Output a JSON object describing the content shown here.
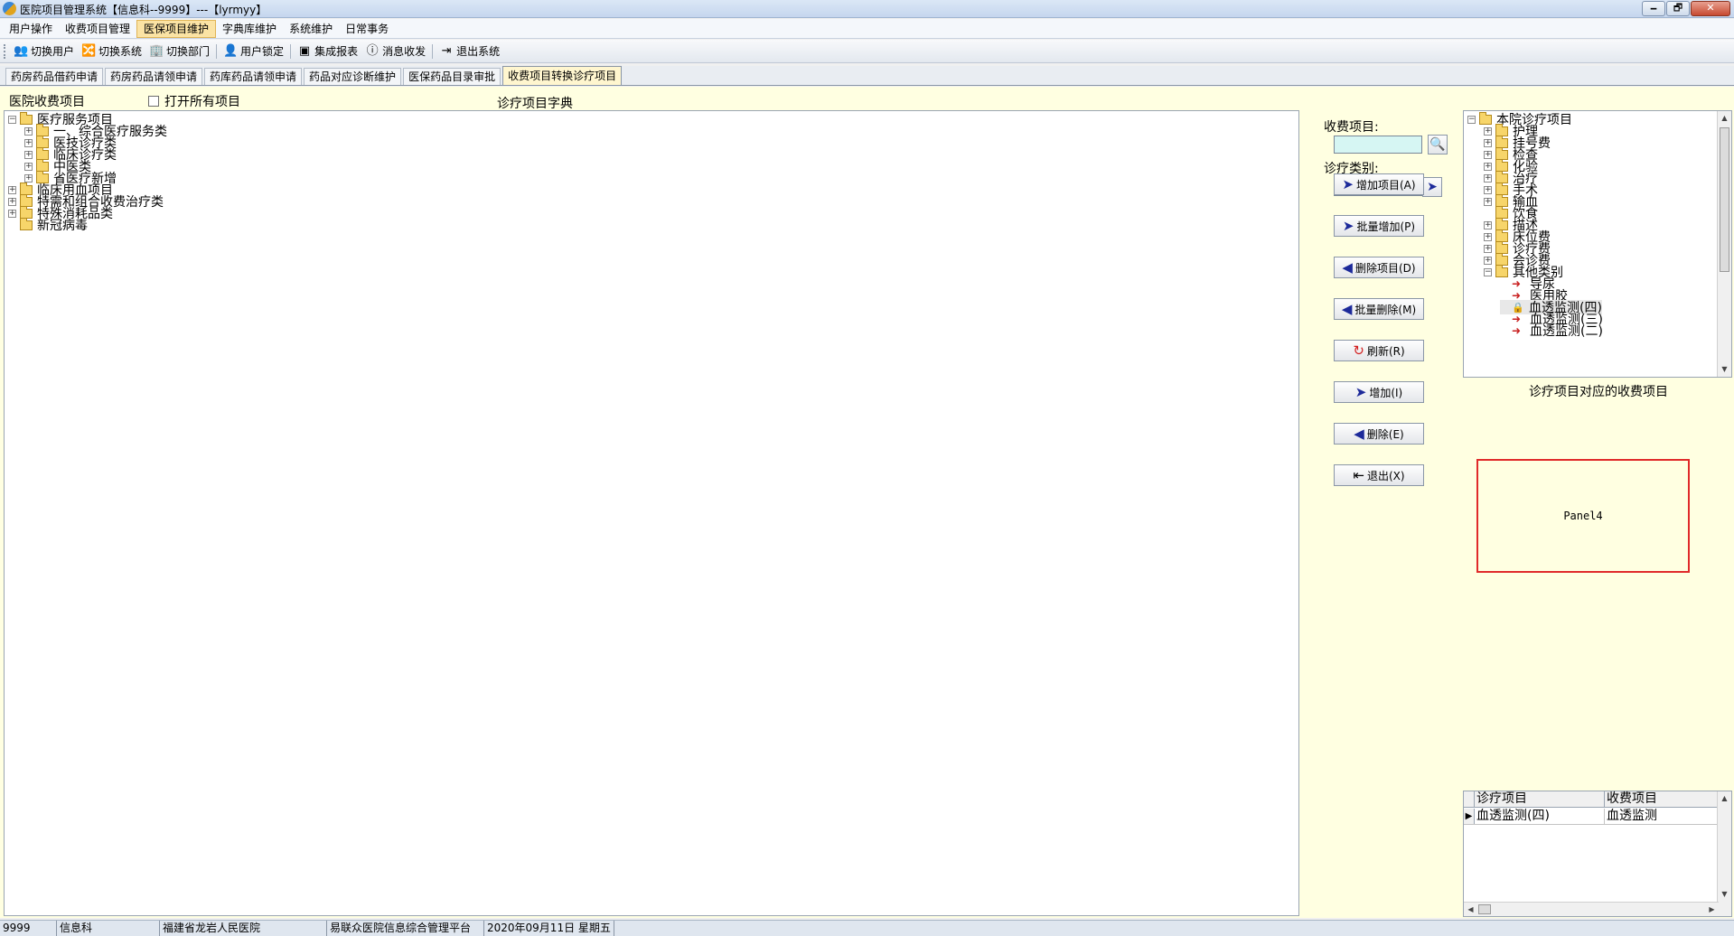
{
  "window": {
    "title": "医院项目管理系统【信息科--9999】---【lyrmyy】",
    "controls": [
      "🗕",
      "🗗",
      "✕"
    ]
  },
  "menu": [
    "用户操作",
    "收费项目管理",
    "医保项目维护",
    "字典库维护",
    "系统维护",
    "日常事务"
  ],
  "toolbar": [
    {
      "label": "切换用户",
      "icon": "users-icon",
      "glyph": "👥"
    },
    {
      "label": "切换系统",
      "icon": "switch-system-icon",
      "glyph": "🔀"
    },
    {
      "label": "切换部门",
      "icon": "department-icon",
      "glyph": "🏢"
    },
    {
      "label": "用户锁定",
      "icon": "user-lock-icon",
      "glyph": "👤"
    },
    {
      "label": "集成报表",
      "icon": "report-icon",
      "glyph": "▣"
    },
    {
      "label": "消息收发",
      "icon": "info-icon",
      "glyph": "ⓘ"
    },
    {
      "label": "退出系统",
      "icon": "exit-icon",
      "glyph": "⇥"
    }
  ],
  "tabs": [
    "药房药品借药申请",
    "药房药品请领申请",
    "药库药品请领申请",
    "药品对应诊断维护",
    "医保药品目录审批",
    "收费项目转换诊疗项目"
  ],
  "main": {
    "left_title": "医院收费项目",
    "open_all_label": "打开所有项目",
    "dict_title": "诊疗项目字典",
    "left_tree": [
      {
        "label": "医疗服务项目",
        "level": 0,
        "expander": "⊟",
        "kind": "folder"
      },
      {
        "label": "一、综合医疗服务类",
        "level": 1,
        "expander": "⊞",
        "kind": "folder"
      },
      {
        "label": "医技诊疗类",
        "level": 1,
        "expander": "⊞",
        "kind": "folder"
      },
      {
        "label": "临床诊疗类",
        "level": 1,
        "expander": "⊞",
        "kind": "folder"
      },
      {
        "label": "中医类",
        "level": 1,
        "expander": "⊞",
        "kind": "folder"
      },
      {
        "label": "省医疗新增",
        "level": 1,
        "expander": "⊞",
        "kind": "folder"
      },
      {
        "label": "临床用血项目",
        "level": 0,
        "expander": "⊞",
        "kind": "folder"
      },
      {
        "label": "特需和组合收费治疗类",
        "level": 0,
        "expander": "⊞",
        "kind": "folder"
      },
      {
        "label": "特殊消耗品类",
        "level": 0,
        "expander": "⊞",
        "kind": "folder"
      },
      {
        "label": "新冠病毒",
        "level": 0,
        "expander": "",
        "kind": "folder"
      }
    ],
    "controls": {
      "charge_item_label": "收费项目:",
      "treat_category_label": "诊疗类别:",
      "charge_item_value": "",
      "treat_category_value": "",
      "buttons": [
        {
          "label": "增加项目(A)",
          "icon": "arrow-right-icon",
          "glyph": "➤",
          "tone": "navy"
        },
        {
          "label": "批量增加(P)",
          "icon": "arrow-right-icon",
          "glyph": "➤",
          "tone": "navy"
        },
        {
          "label": "删除项目(D)",
          "icon": "arrow-left-icon",
          "glyph": "◀",
          "tone": "navy"
        },
        {
          "label": "批量删除(M)",
          "icon": "arrow-left-icon",
          "glyph": "◀",
          "tone": "navy"
        },
        {
          "label": "刷新(R)",
          "icon": "refresh-icon",
          "glyph": "↻",
          "tone": "red"
        },
        {
          "label": "增加(I)",
          "icon": "arrow-right-icon",
          "glyph": "➤",
          "tone": "navy"
        },
        {
          "label": "删除(E)",
          "icon": "arrow-left-icon",
          "glyph": "◀",
          "tone": "navy"
        },
        {
          "label": "退出(X)",
          "icon": "exit-door-icon",
          "glyph": "⇤",
          "tone": "dark"
        }
      ]
    },
    "right_tree": [
      {
        "label": "本院诊疗项目",
        "level": 0,
        "expander": "⊟",
        "kind": "folder"
      },
      {
        "label": "护理",
        "level": 1,
        "expander": "⊞",
        "kind": "folder"
      },
      {
        "label": "挂号费",
        "level": 1,
        "expander": "⊞",
        "kind": "folder"
      },
      {
        "label": "检查",
        "level": 1,
        "expander": "⊞",
        "kind": "folder"
      },
      {
        "label": "化验",
        "level": 1,
        "expander": "⊞",
        "kind": "folder"
      },
      {
        "label": "治疗",
        "level": 1,
        "expander": "⊞",
        "kind": "folder"
      },
      {
        "label": "手术",
        "level": 1,
        "expander": "⊞",
        "kind": "folder"
      },
      {
        "label": "输血",
        "level": 1,
        "expander": "⊞",
        "kind": "folder"
      },
      {
        "label": "饮食",
        "level": 1,
        "expander": "",
        "kind": "folder"
      },
      {
        "label": "描述",
        "level": 1,
        "expander": "⊞",
        "kind": "folder"
      },
      {
        "label": "床位费",
        "level": 1,
        "expander": "⊞",
        "kind": "folder"
      },
      {
        "label": "诊疗费",
        "level": 1,
        "expander": "⊞",
        "kind": "folder"
      },
      {
        "label": "会诊费",
        "level": 1,
        "expander": "⊞",
        "kind": "folder"
      },
      {
        "label": "其他类别",
        "level": 1,
        "expander": "⊟",
        "kind": "folder"
      },
      {
        "label": "导尿",
        "level": 2,
        "expander": "",
        "kind": "arrow"
      },
      {
        "label": "医用胶",
        "level": 2,
        "expander": "",
        "kind": "arrow"
      },
      {
        "label": "血透监测(四)",
        "level": 2,
        "expander": "",
        "kind": "person",
        "selected": true
      },
      {
        "label": "血透监测(三)",
        "level": 2,
        "expander": "",
        "kind": "arrow"
      },
      {
        "label": "血透监测(二)",
        "level": 2,
        "expander": "",
        "kind": "arrow"
      }
    ],
    "mapping_title": "诊疗项目对应的收费项目",
    "panel_label": "Panel4",
    "grid": {
      "columns": [
        "诊疗项目",
        "收费项目"
      ],
      "rows": [
        {
          "indicator": "▶",
          "cells": [
            "血透监测(四)",
            "血透监测"
          ]
        }
      ]
    }
  },
  "status": [
    "9999",
    "信息科",
    "福建省龙岩人民医院",
    "易联众医院信息综合管理平台",
    "2020年09月11日 星期五"
  ],
  "colors": {
    "content_bg": "#ffffe1",
    "active_tab": "#fff6cf",
    "panel_border": "#e02a2a",
    "input_cyan": "#d6f6f3"
  }
}
